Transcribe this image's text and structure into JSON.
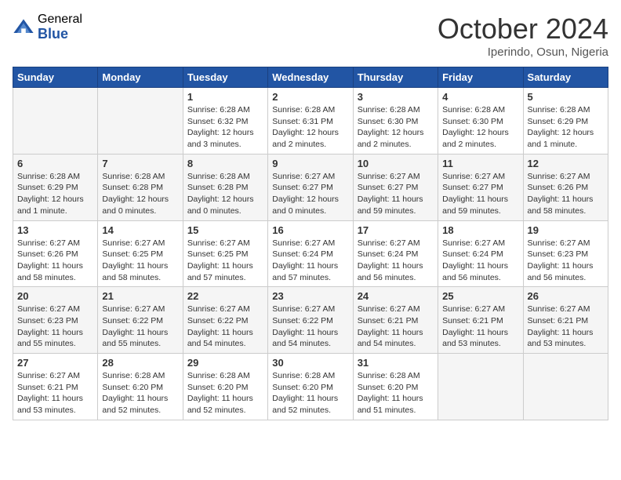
{
  "header": {
    "logo_general": "General",
    "logo_blue": "Blue",
    "month_title": "October 2024",
    "location": "Iperindo, Osun, Nigeria"
  },
  "columns": [
    "Sunday",
    "Monday",
    "Tuesday",
    "Wednesday",
    "Thursday",
    "Friday",
    "Saturday"
  ],
  "weeks": [
    [
      {
        "day": "",
        "empty": true
      },
      {
        "day": "",
        "empty": true
      },
      {
        "day": "1",
        "sunrise": "6:28 AM",
        "sunset": "6:32 PM",
        "daylight": "12 hours and 3 minutes."
      },
      {
        "day": "2",
        "sunrise": "6:28 AM",
        "sunset": "6:31 PM",
        "daylight": "12 hours and 2 minutes."
      },
      {
        "day": "3",
        "sunrise": "6:28 AM",
        "sunset": "6:30 PM",
        "daylight": "12 hours and 2 minutes."
      },
      {
        "day": "4",
        "sunrise": "6:28 AM",
        "sunset": "6:30 PM",
        "daylight": "12 hours and 2 minutes."
      },
      {
        "day": "5",
        "sunrise": "6:28 AM",
        "sunset": "6:29 PM",
        "daylight": "12 hours and 1 minute."
      }
    ],
    [
      {
        "day": "6",
        "sunrise": "6:28 AM",
        "sunset": "6:29 PM",
        "daylight": "12 hours and 1 minute."
      },
      {
        "day": "7",
        "sunrise": "6:28 AM",
        "sunset": "6:28 PM",
        "daylight": "12 hours and 0 minutes."
      },
      {
        "day": "8",
        "sunrise": "6:28 AM",
        "sunset": "6:28 PM",
        "daylight": "12 hours and 0 minutes."
      },
      {
        "day": "9",
        "sunrise": "6:27 AM",
        "sunset": "6:27 PM",
        "daylight": "12 hours and 0 minutes."
      },
      {
        "day": "10",
        "sunrise": "6:27 AM",
        "sunset": "6:27 PM",
        "daylight": "11 hours and 59 minutes."
      },
      {
        "day": "11",
        "sunrise": "6:27 AM",
        "sunset": "6:27 PM",
        "daylight": "11 hours and 59 minutes."
      },
      {
        "day": "12",
        "sunrise": "6:27 AM",
        "sunset": "6:26 PM",
        "daylight": "11 hours and 58 minutes."
      }
    ],
    [
      {
        "day": "13",
        "sunrise": "6:27 AM",
        "sunset": "6:26 PM",
        "daylight": "11 hours and 58 minutes."
      },
      {
        "day": "14",
        "sunrise": "6:27 AM",
        "sunset": "6:25 PM",
        "daylight": "11 hours and 58 minutes."
      },
      {
        "day": "15",
        "sunrise": "6:27 AM",
        "sunset": "6:25 PM",
        "daylight": "11 hours and 57 minutes."
      },
      {
        "day": "16",
        "sunrise": "6:27 AM",
        "sunset": "6:24 PM",
        "daylight": "11 hours and 57 minutes."
      },
      {
        "day": "17",
        "sunrise": "6:27 AM",
        "sunset": "6:24 PM",
        "daylight": "11 hours and 56 minutes."
      },
      {
        "day": "18",
        "sunrise": "6:27 AM",
        "sunset": "6:24 PM",
        "daylight": "11 hours and 56 minutes."
      },
      {
        "day": "19",
        "sunrise": "6:27 AM",
        "sunset": "6:23 PM",
        "daylight": "11 hours and 56 minutes."
      }
    ],
    [
      {
        "day": "20",
        "sunrise": "6:27 AM",
        "sunset": "6:23 PM",
        "daylight": "11 hours and 55 minutes."
      },
      {
        "day": "21",
        "sunrise": "6:27 AM",
        "sunset": "6:22 PM",
        "daylight": "11 hours and 55 minutes."
      },
      {
        "day": "22",
        "sunrise": "6:27 AM",
        "sunset": "6:22 PM",
        "daylight": "11 hours and 54 minutes."
      },
      {
        "day": "23",
        "sunrise": "6:27 AM",
        "sunset": "6:22 PM",
        "daylight": "11 hours and 54 minutes."
      },
      {
        "day": "24",
        "sunrise": "6:27 AM",
        "sunset": "6:21 PM",
        "daylight": "11 hours and 54 minutes."
      },
      {
        "day": "25",
        "sunrise": "6:27 AM",
        "sunset": "6:21 PM",
        "daylight": "11 hours and 53 minutes."
      },
      {
        "day": "26",
        "sunrise": "6:27 AM",
        "sunset": "6:21 PM",
        "daylight": "11 hours and 53 minutes."
      }
    ],
    [
      {
        "day": "27",
        "sunrise": "6:27 AM",
        "sunset": "6:21 PM",
        "daylight": "11 hours and 53 minutes."
      },
      {
        "day": "28",
        "sunrise": "6:28 AM",
        "sunset": "6:20 PM",
        "daylight": "11 hours and 52 minutes."
      },
      {
        "day": "29",
        "sunrise": "6:28 AM",
        "sunset": "6:20 PM",
        "daylight": "11 hours and 52 minutes."
      },
      {
        "day": "30",
        "sunrise": "6:28 AM",
        "sunset": "6:20 PM",
        "daylight": "11 hours and 52 minutes."
      },
      {
        "day": "31",
        "sunrise": "6:28 AM",
        "sunset": "6:20 PM",
        "daylight": "11 hours and 51 minutes."
      },
      {
        "day": "",
        "empty": true
      },
      {
        "day": "",
        "empty": true
      }
    ]
  ]
}
